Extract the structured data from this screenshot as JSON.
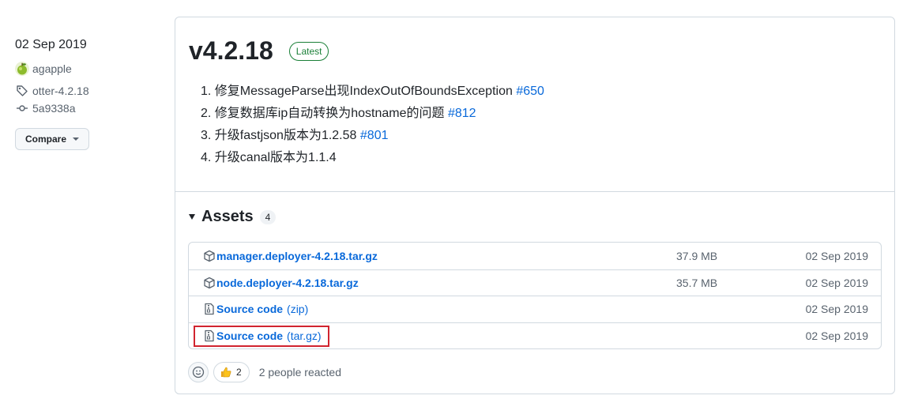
{
  "release": {
    "date": "02 Sep 2019",
    "author": "agapple",
    "tag": "otter-4.2.18",
    "commit": "5a9338a",
    "compare_label": "Compare",
    "version": "v4.2.18",
    "latest_label": "Latest"
  },
  "notes": [
    {
      "index": "1.",
      "text": "修复MessageParse出现IndexOutOfBoundsException",
      "ref": "#650"
    },
    {
      "index": "2.",
      "text": "修复数据库ip自动转换为hostname的问题",
      "ref": "#812"
    },
    {
      "index": "3.",
      "text": "升级fastjson版本为1.2.58",
      "ref": "#801"
    },
    {
      "index": "4.",
      "text": "升级canal版本为1.1.4",
      "ref": ""
    }
  ],
  "assets": {
    "title": "Assets",
    "count": "4",
    "items": [
      {
        "name": "manager.deployer-4.2.18.tar.gz",
        "ext": "",
        "size": "37.9 MB",
        "date": "02 Sep 2019",
        "icon": "package-icon"
      },
      {
        "name": "node.deployer-4.2.18.tar.gz",
        "ext": "",
        "size": "35.7 MB",
        "date": "02 Sep 2019",
        "icon": "package-icon"
      },
      {
        "name": "Source code",
        "ext": "(zip)",
        "size": "",
        "date": "02 Sep 2019",
        "icon": "file-zip-icon"
      },
      {
        "name": "Source code",
        "ext": "(tar.gz)",
        "size": "",
        "date": "02 Sep 2019",
        "icon": "file-zip-icon"
      }
    ]
  },
  "reactions": {
    "thumbs_count": "2",
    "summary": "2 people reacted"
  },
  "colors": {
    "link": "#0969da",
    "latest": "#1a7f37",
    "highlight": "#d1242f"
  }
}
